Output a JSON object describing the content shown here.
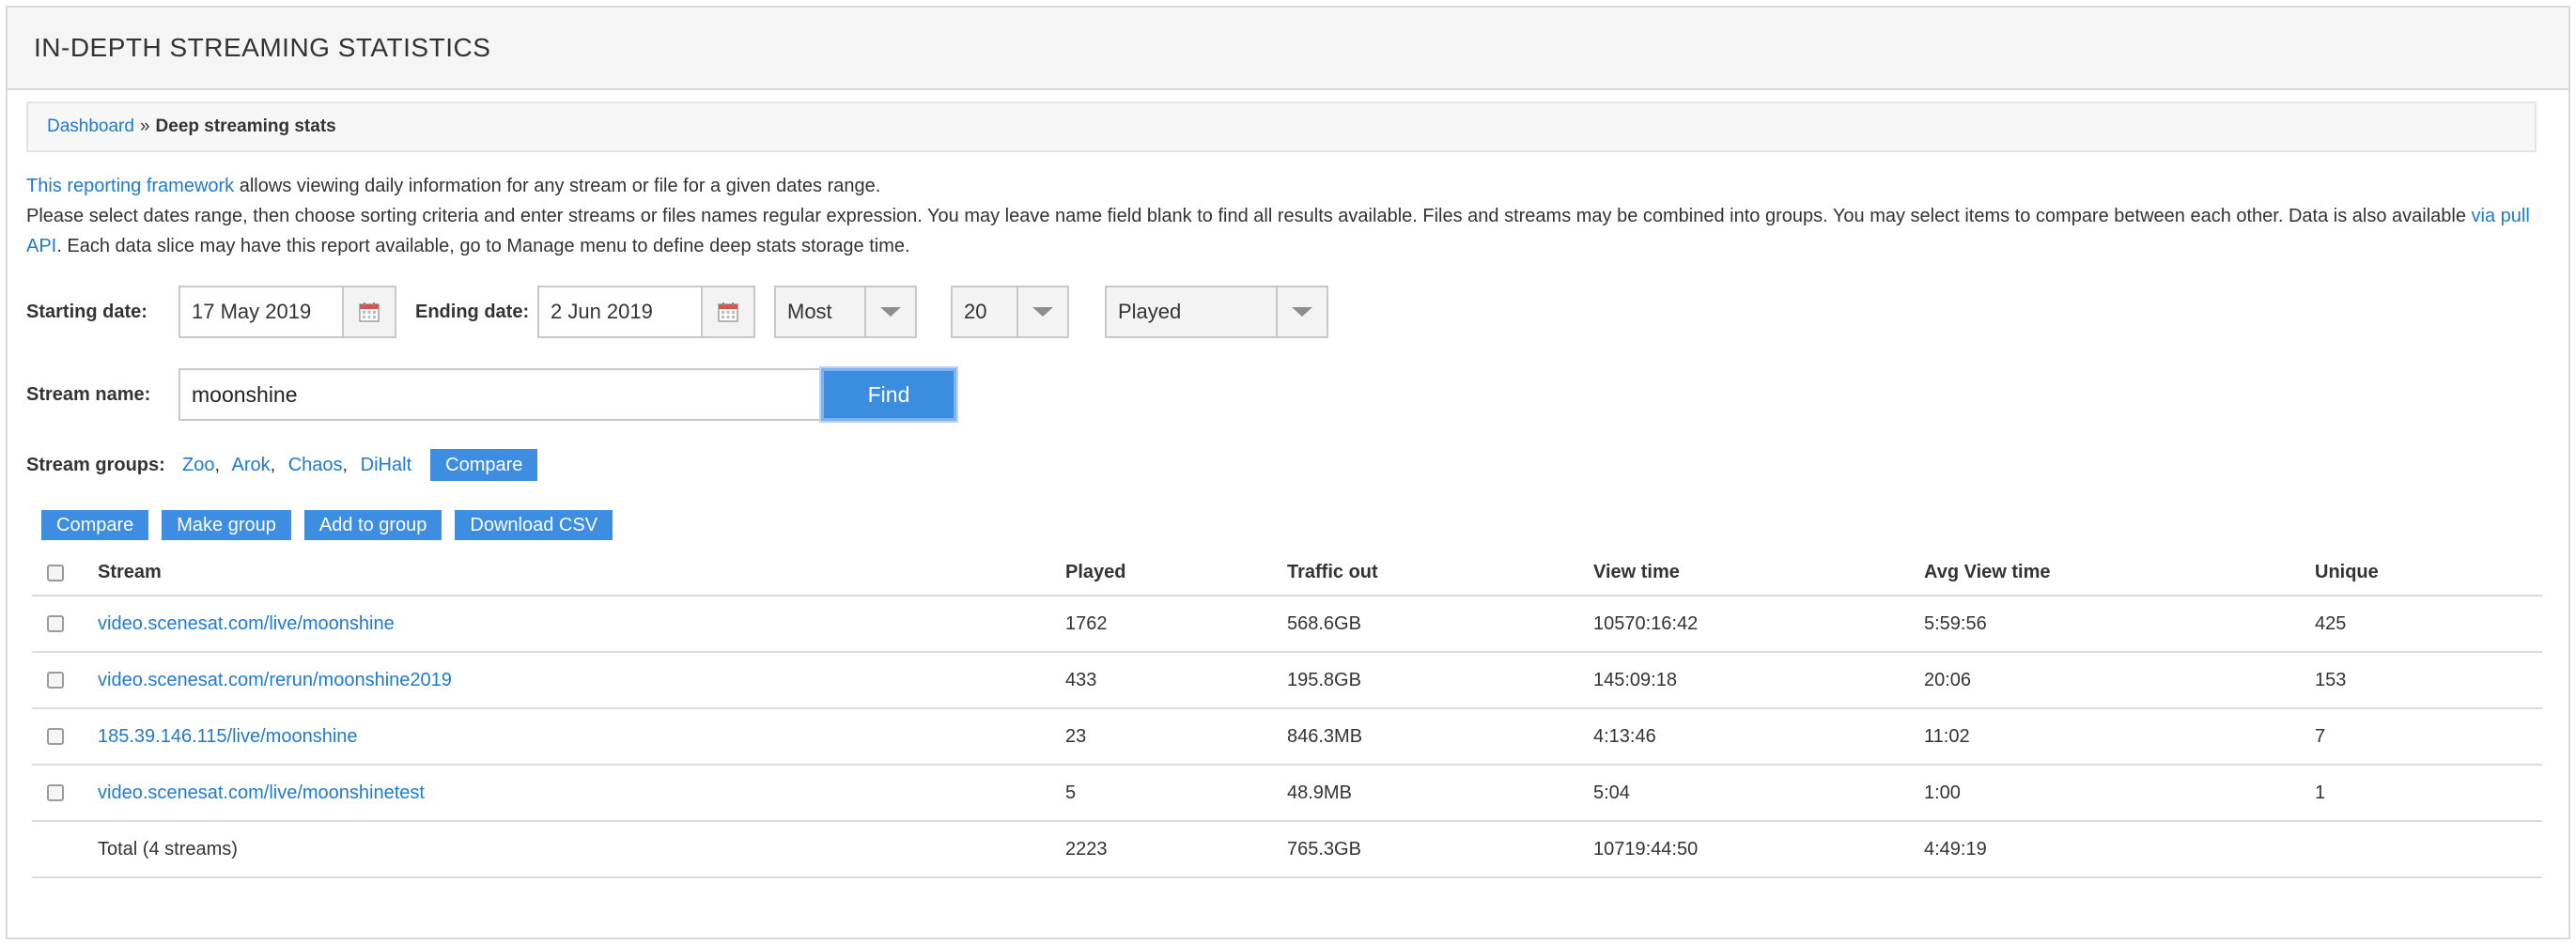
{
  "header": {
    "title": "IN-DEPTH STREAMING STATISTICS"
  },
  "breadcrumb": {
    "home": "Dashboard",
    "separator": "»",
    "current": "Deep streaming stats"
  },
  "description": {
    "link1": "This reporting framework",
    "line1_rest": " allows viewing daily information for any stream or file for a given dates range.",
    "line2": "Please select dates range, then choose sorting criteria and enter streams or files names regular expression. You may leave name field blank to find all results available. Files and streams may be combined into groups. You may select items to compare between each other. Data is also available ",
    "link2": "via pull API",
    "line2_rest": ". Each data slice may have this report available, go to Manage menu to define deep stats storage time."
  },
  "filters": {
    "start_label": "Starting date:",
    "start_value": "17 May 2019",
    "end_label": "Ending date:",
    "end_value": "2 Jun 2019",
    "order_value": "Most",
    "limit_value": "20",
    "metric_value": "Played"
  },
  "search": {
    "label": "Stream name:",
    "value": "moonshine",
    "find_label": "Find"
  },
  "groups": {
    "label": "Stream groups:",
    "items": [
      "Zoo",
      "Arok",
      "Chaos",
      "DiHalt"
    ],
    "compare_label": "Compare"
  },
  "actions": {
    "compare": "Compare",
    "make_group": "Make group",
    "add_to_group": "Add to group",
    "download_csv": "Download CSV"
  },
  "table": {
    "headers": [
      "Stream",
      "Played",
      "Traffic out",
      "View time",
      "Avg View time",
      "Unique"
    ],
    "rows": [
      [
        "video.scenesat.com/live/moonshine",
        "1762",
        "568.6GB",
        "10570:16:42",
        "5:59:56",
        "425"
      ],
      [
        "video.scenesat.com/rerun/moonshine2019",
        "433",
        "195.8GB",
        "145:09:18",
        "20:06",
        "153"
      ],
      [
        "185.39.146.115/live/moonshine",
        "23",
        "846.3MB",
        "4:13:46",
        "11:02",
        "7"
      ],
      [
        "video.scenesat.com/live/moonshinetest",
        "5",
        "48.9MB",
        "5:04",
        "1:00",
        "1"
      ]
    ],
    "total": [
      "Total (4 streams)",
      "2223",
      "765.3GB",
      "10719:44:50",
      "4:49:19",
      ""
    ]
  }
}
